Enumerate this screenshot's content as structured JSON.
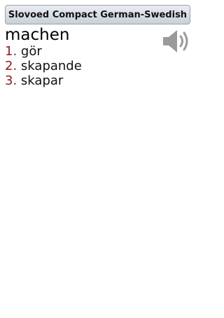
{
  "header": {
    "title": "Slovoed Compact German-Swedish"
  },
  "entry": {
    "headword": "machen",
    "audio_icon": "speaker-icon",
    "translations": [
      {
        "number": "1.",
        "text": "gör"
      },
      {
        "number": "2.",
        "text": "skapande"
      },
      {
        "number": "3.",
        "text": "skapar"
      }
    ]
  },
  "colors": {
    "number_color": "#8b1a1a",
    "title_bar_top": "#e9edf2",
    "title_bar_bottom": "#c8d0d9"
  }
}
